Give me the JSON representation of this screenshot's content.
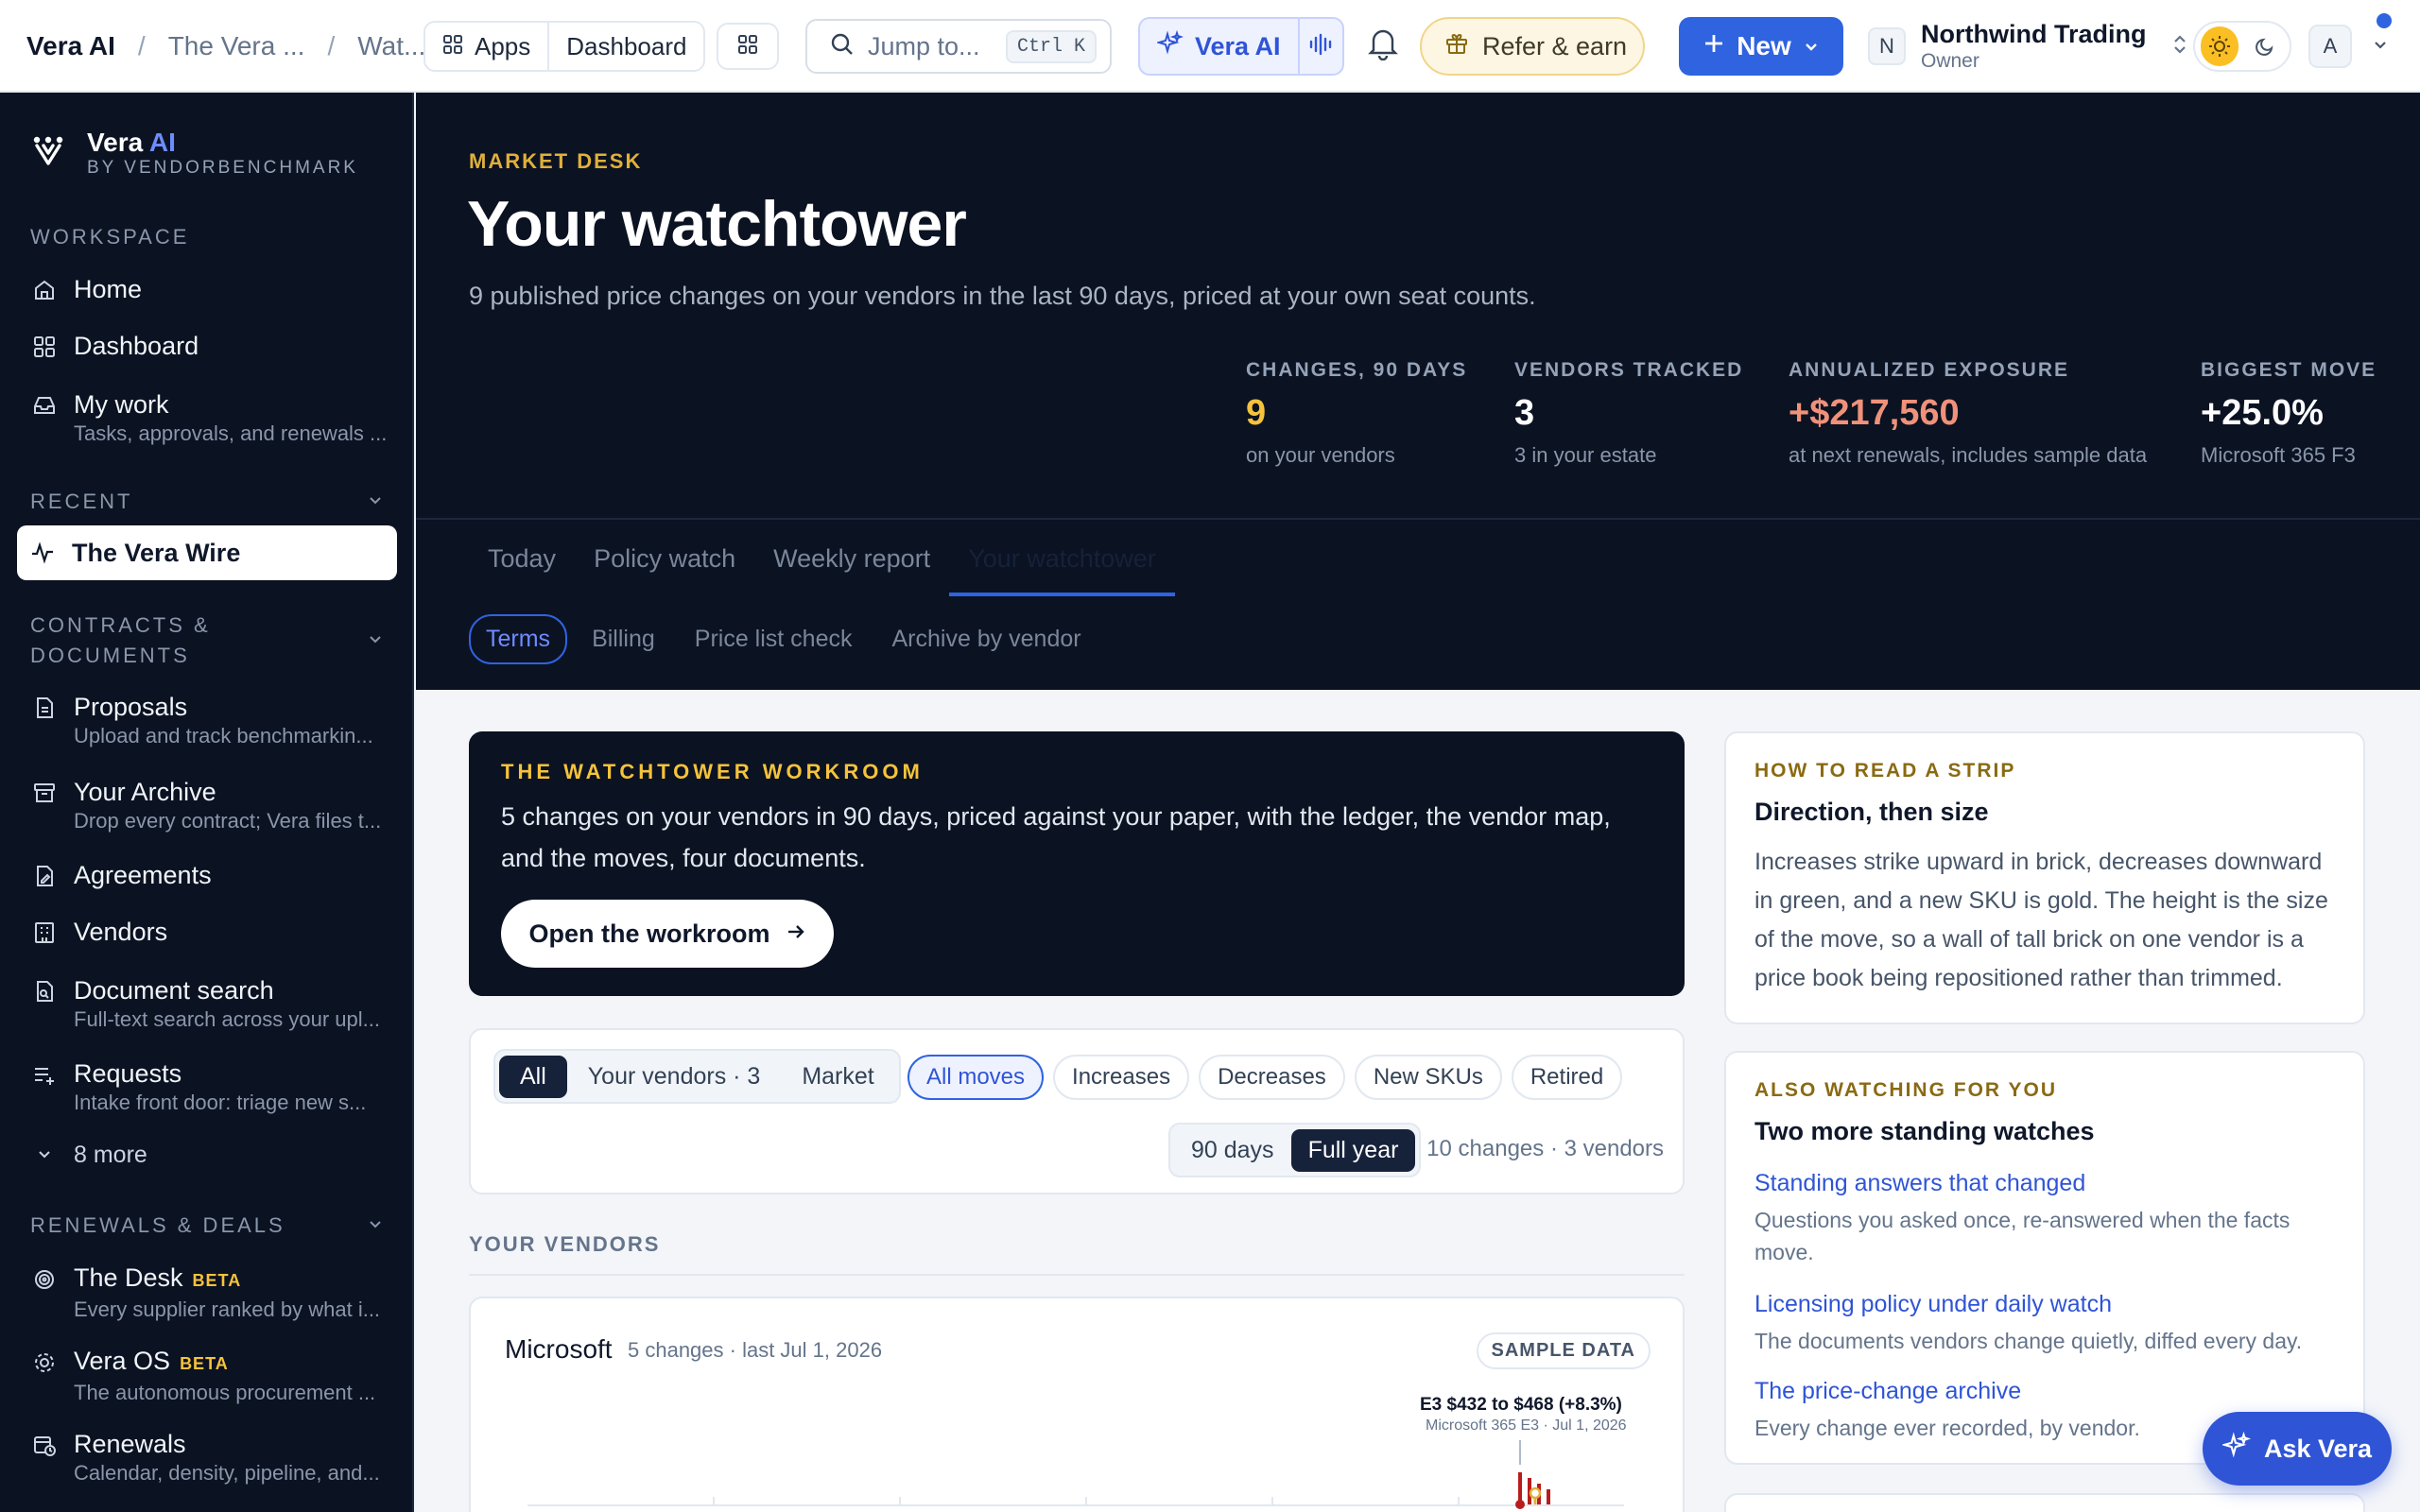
{
  "topbar": {
    "breadcrumb": [
      "Vera AI",
      "The Vera ...",
      "Wat..."
    ],
    "apps_label": "Apps",
    "dashboard_label": "Dashboard",
    "search_placeholder": "Jump to...",
    "search_shortcut": "Ctrl K",
    "vera_ai_label": "Vera AI",
    "refer_label": "Refer & earn",
    "new_label": "New",
    "org_initial": "N",
    "org_name": "Northwind Trading",
    "org_role": "Owner",
    "user_initial": "A"
  },
  "sidebar": {
    "brand_name": "Vera",
    "brand_ai": "AI",
    "brand_by": "BY VENDORBENCHMARK",
    "workspace_label": "WORKSPACE",
    "workspace_items": [
      {
        "label": "Home",
        "sub": ""
      },
      {
        "label": "Dashboard",
        "sub": ""
      },
      {
        "label": "My work",
        "sub": "Tasks, approvals, and renewals ..."
      }
    ],
    "recent_label": "RECENT",
    "recent_items": [
      {
        "label": "The Vera Wire"
      }
    ],
    "contracts_label_1": "CONTRACTS &",
    "contracts_label_2": "DOCUMENTS",
    "contracts_items": [
      {
        "label": "Proposals",
        "sub": "Upload and track benchmarkin..."
      },
      {
        "label": "Your Archive",
        "sub": "Drop every contract; Vera files t..."
      },
      {
        "label": "Agreements",
        "sub": ""
      },
      {
        "label": "Vendors",
        "sub": ""
      },
      {
        "label": "Document search",
        "sub": "Full-text search across your upl..."
      },
      {
        "label": "Requests",
        "sub": "Intake front door: triage new s..."
      }
    ],
    "more_label": "8 more",
    "renewals_label": "RENEWALS & DEALS",
    "renewals_items": [
      {
        "label": "The Desk",
        "badge": "BETA",
        "sub": "Every supplier ranked by what i..."
      },
      {
        "label": "Vera OS",
        "badge": "BETA",
        "sub": "The autonomous procurement ..."
      },
      {
        "label": "Renewals",
        "badge": "",
        "sub": "Calendar, density, pipeline, and..."
      }
    ]
  },
  "hero": {
    "eyebrow": "MARKET DESK",
    "title": "Your watchtower",
    "lead": "9 published price changes on your vendors in the last 90 days, priced at your own seat counts.",
    "stats": [
      {
        "label": "CHANGES, 90 DAYS",
        "value": "9",
        "sub": "on your vendors",
        "color": "#f5c33b"
      },
      {
        "label": "VENDORS TRACKED",
        "value": "3",
        "sub": "3 in your estate",
        "color": "#ffffff"
      },
      {
        "label": "ANNUALIZED EXPOSURE",
        "value": "+$217,560",
        "sub": "at next renewals, includes sample data",
        "color": "#f0917a"
      },
      {
        "label": "BIGGEST MOVE",
        "value": "+25.0%",
        "sub": "Microsoft 365 F3",
        "color": "#ffffff"
      }
    ],
    "tabs": [
      "Today",
      "Policy watch",
      "Weekly report",
      "Your watchtower"
    ],
    "subtabs": [
      "Terms",
      "Billing",
      "Price list check",
      "Archive by vendor"
    ]
  },
  "workroom": {
    "kicker": "THE WATCHTOWER WORKROOM",
    "desc": "5 changes on your vendors in 90 days, priced against your paper, with the ledger, the vendor map, and the moves, four documents.",
    "button": "Open the workroom"
  },
  "filters": {
    "scope": [
      "All",
      "Your vendors · 3",
      "Market"
    ],
    "moves": [
      "All moves",
      "Increases",
      "Decreases",
      "New SKUs",
      "Retired"
    ],
    "range": [
      "90 days",
      "Full year"
    ],
    "count": "10 changes · 3 vendors"
  },
  "your_vendors_label": "YOUR VENDORS",
  "vendor_card": {
    "name": "Microsoft",
    "meta": "5 changes · last Jul 1, 2026",
    "badge": "SAMPLE DATA",
    "annotation_title": "E3 $432 to $468 (+8.3%)",
    "annotation_sub": "Microsoft 365 E3 · Jul 1, 2026"
  },
  "rail": {
    "read": {
      "kicker": "HOW TO READ A STRIP",
      "title": "Direction, then size",
      "body": "Increases strike upward in brick, decreases downward in green, and a new SKU is gold. The height is the size of the move, so a wall of tall brick on one vendor is a price book being repositioned rather than trimmed."
    },
    "watch": {
      "kicker": "ALSO WATCHING FOR YOU",
      "title": "Two more standing watches",
      "links": [
        {
          "label": "Standing answers that changed",
          "desc": "Questions you asked once, re-answered when the facts move."
        },
        {
          "label": "Licensing policy under daily watch",
          "desc": "The documents vendors change quietly, diffed every day."
        },
        {
          "label": "The price-change archive",
          "desc": "Every change ever recorded, by vendor."
        }
      ]
    }
  },
  "ask_vera": "Ask Vera"
}
